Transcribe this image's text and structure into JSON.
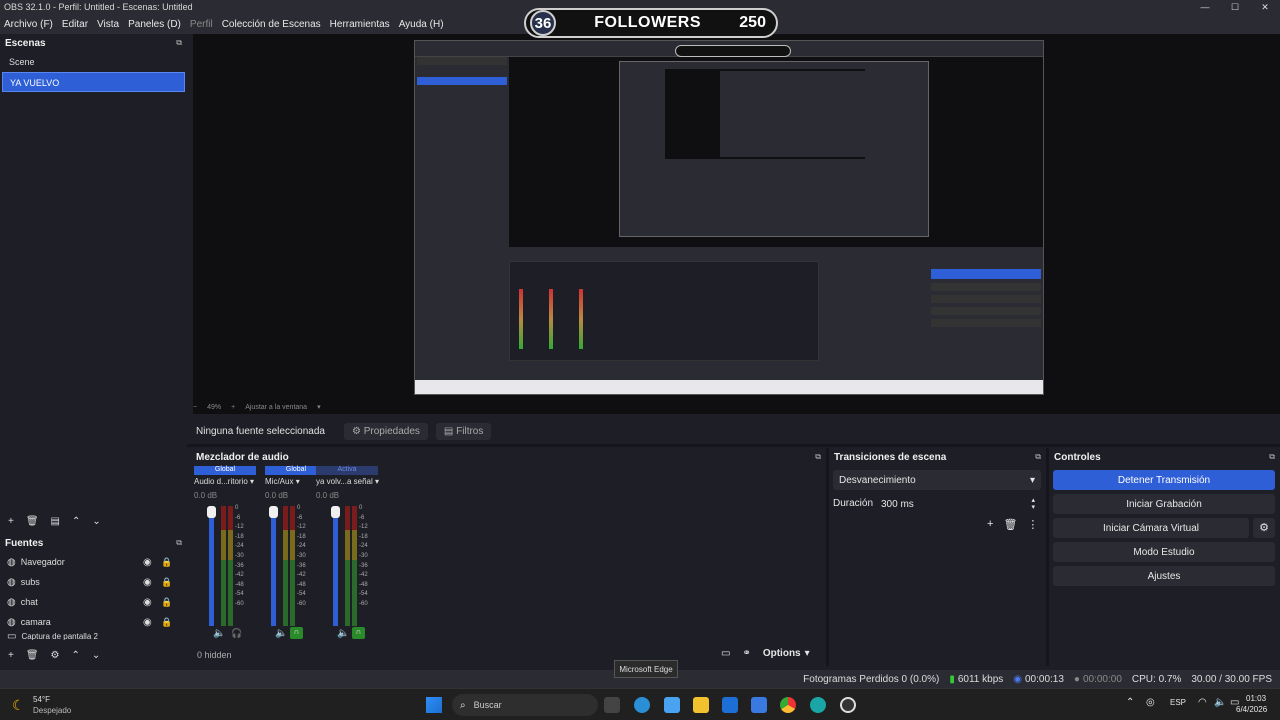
{
  "window": {
    "title": "OBS 32.1.0 - Perfil: Untitled - Escenas: Untitled",
    "controls": [
      "—",
      "☐",
      "✕"
    ]
  },
  "menu": {
    "items": [
      "Archivo (F)",
      "Editar",
      "Vista",
      "Paneles (D)"
    ],
    "dim_item": "Perfil",
    "items2": [
      "Colección de Escenas",
      "Herramientas",
      "Ayuda (H)"
    ]
  },
  "overlay": {
    "left_num": "36",
    "label": "FOLLOWERS",
    "right_num": "250"
  },
  "scenes": {
    "header": "Escenas",
    "items": [
      "Scene",
      "YA VUELVO"
    ],
    "selected": 1
  },
  "sources": {
    "header": "Fuentes",
    "items": [
      "Navegador",
      "subs",
      "chat",
      "camara",
      "Captura de pantalla 2"
    ]
  },
  "preview": {
    "zoom": "49%",
    "fit_label": "Ajustar a la ventana"
  },
  "propbar": {
    "no_selection": "Ninguna fuente seleccionada",
    "properties": "Propiedades",
    "filters": "Filtros"
  },
  "mixer": {
    "header": "Mezclador de audio",
    "channels": [
      {
        "mode": "Global",
        "name": "Audio d...ritorio",
        "db": "0.0 dB",
        "mode_color": "#2f5fd6"
      },
      {
        "mode": "Global",
        "name": "Mic/Aux",
        "db": "0.0 dB",
        "mode_color": "#2f5fd6"
      },
      {
        "mode": "Activa",
        "name": "ya volv...a señal",
        "db": "0.0 dB",
        "mode_color": "#2c3b6e"
      }
    ],
    "scale": [
      "0",
      "-6",
      "-12",
      "-18",
      "-24",
      "-30",
      "-36",
      "-42",
      "-48",
      "-54",
      "-60"
    ],
    "hidden": "0 hidden",
    "options": "Options"
  },
  "transitions": {
    "header": "Transiciones de escena",
    "selected": "Desvanecimiento",
    "duration_label": "Duración",
    "duration_value": "300 ms"
  },
  "controls": {
    "header": "Controles",
    "buttons": [
      "Detener Transmisión",
      "Iniciar Grabación",
      "Iniciar Cámara Virtual",
      "Modo Estudio",
      "Ajustes"
    ]
  },
  "status": {
    "frames": "Fotogramas Perdidos 0 (0.0%)",
    "kbps": "6011 kbps",
    "stream_time": "00:00:13",
    "rec_time": "00:00:00",
    "cpu": "CPU: 0.7%",
    "fps": "30.00 / 30.00 FPS"
  },
  "tooltip": "Microsoft Edge",
  "taskbar": {
    "weather_temp": "54°F",
    "weather_desc": "Despejado",
    "search": "Buscar",
    "lang": "ESP",
    "time": "01:03",
    "date": "6/4/2026"
  }
}
